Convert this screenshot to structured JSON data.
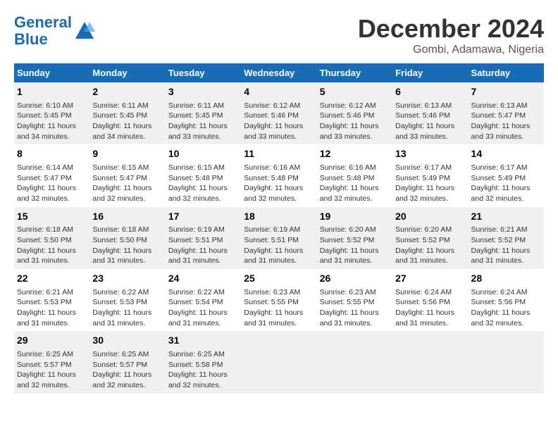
{
  "logo": {
    "line1": "General",
    "line2": "Blue"
  },
  "title": "December 2024",
  "location": "Gombi, Adamawa, Nigeria",
  "headers": [
    "Sunday",
    "Monday",
    "Tuesday",
    "Wednesday",
    "Thursday",
    "Friday",
    "Saturday"
  ],
  "weeks": [
    [
      {
        "day": "1",
        "info": "Sunrise: 6:10 AM\nSunset: 5:45 PM\nDaylight: 11 hours\nand 34 minutes."
      },
      {
        "day": "2",
        "info": "Sunrise: 6:11 AM\nSunset: 5:45 PM\nDaylight: 11 hours\nand 34 minutes."
      },
      {
        "day": "3",
        "info": "Sunrise: 6:11 AM\nSunset: 5:45 PM\nDaylight: 11 hours\nand 33 minutes."
      },
      {
        "day": "4",
        "info": "Sunrise: 6:12 AM\nSunset: 5:46 PM\nDaylight: 11 hours\nand 33 minutes."
      },
      {
        "day": "5",
        "info": "Sunrise: 6:12 AM\nSunset: 5:46 PM\nDaylight: 11 hours\nand 33 minutes."
      },
      {
        "day": "6",
        "info": "Sunrise: 6:13 AM\nSunset: 5:46 PM\nDaylight: 11 hours\nand 33 minutes."
      },
      {
        "day": "7",
        "info": "Sunrise: 6:13 AM\nSunset: 5:47 PM\nDaylight: 11 hours\nand 33 minutes."
      }
    ],
    [
      {
        "day": "8",
        "info": "Sunrise: 6:14 AM\nSunset: 5:47 PM\nDaylight: 11 hours\nand 32 minutes."
      },
      {
        "day": "9",
        "info": "Sunrise: 6:15 AM\nSunset: 5:47 PM\nDaylight: 11 hours\nand 32 minutes."
      },
      {
        "day": "10",
        "info": "Sunrise: 6:15 AM\nSunset: 5:48 PM\nDaylight: 11 hours\nand 32 minutes."
      },
      {
        "day": "11",
        "info": "Sunrise: 6:16 AM\nSunset: 5:48 PM\nDaylight: 11 hours\nand 32 minutes."
      },
      {
        "day": "12",
        "info": "Sunrise: 6:16 AM\nSunset: 5:48 PM\nDaylight: 11 hours\nand 32 minutes."
      },
      {
        "day": "13",
        "info": "Sunrise: 6:17 AM\nSunset: 5:49 PM\nDaylight: 11 hours\nand 32 minutes."
      },
      {
        "day": "14",
        "info": "Sunrise: 6:17 AM\nSunset: 5:49 PM\nDaylight: 11 hours\nand 32 minutes."
      }
    ],
    [
      {
        "day": "15",
        "info": "Sunrise: 6:18 AM\nSunset: 5:50 PM\nDaylight: 11 hours\nand 31 minutes."
      },
      {
        "day": "16",
        "info": "Sunrise: 6:18 AM\nSunset: 5:50 PM\nDaylight: 11 hours\nand 31 minutes."
      },
      {
        "day": "17",
        "info": "Sunrise: 6:19 AM\nSunset: 5:51 PM\nDaylight: 11 hours\nand 31 minutes."
      },
      {
        "day": "18",
        "info": "Sunrise: 6:19 AM\nSunset: 5:51 PM\nDaylight: 11 hours\nand 31 minutes."
      },
      {
        "day": "19",
        "info": "Sunrise: 6:20 AM\nSunset: 5:52 PM\nDaylight: 11 hours\nand 31 minutes."
      },
      {
        "day": "20",
        "info": "Sunrise: 6:20 AM\nSunset: 5:52 PM\nDaylight: 11 hours\nand 31 minutes."
      },
      {
        "day": "21",
        "info": "Sunrise: 6:21 AM\nSunset: 5:52 PM\nDaylight: 11 hours\nand 31 minutes."
      }
    ],
    [
      {
        "day": "22",
        "info": "Sunrise: 6:21 AM\nSunset: 5:53 PM\nDaylight: 11 hours\nand 31 minutes."
      },
      {
        "day": "23",
        "info": "Sunrise: 6:22 AM\nSunset: 5:53 PM\nDaylight: 11 hours\nand 31 minutes."
      },
      {
        "day": "24",
        "info": "Sunrise: 6:22 AM\nSunset: 5:54 PM\nDaylight: 11 hours\nand 31 minutes."
      },
      {
        "day": "25",
        "info": "Sunrise: 6:23 AM\nSunset: 5:55 PM\nDaylight: 11 hours\nand 31 minutes."
      },
      {
        "day": "26",
        "info": "Sunrise: 6:23 AM\nSunset: 5:55 PM\nDaylight: 11 hours\nand 31 minutes."
      },
      {
        "day": "27",
        "info": "Sunrise: 6:24 AM\nSunset: 5:56 PM\nDaylight: 11 hours\nand 31 minutes."
      },
      {
        "day": "28",
        "info": "Sunrise: 6:24 AM\nSunset: 5:56 PM\nDaylight: 11 hours\nand 32 minutes."
      }
    ],
    [
      {
        "day": "29",
        "info": "Sunrise: 6:25 AM\nSunset: 5:57 PM\nDaylight: 11 hours\nand 32 minutes."
      },
      {
        "day": "30",
        "info": "Sunrise: 6:25 AM\nSunset: 5:57 PM\nDaylight: 11 hours\nand 32 minutes."
      },
      {
        "day": "31",
        "info": "Sunrise: 6:25 AM\nSunset: 5:58 PM\nDaylight: 11 hours\nand 32 minutes."
      },
      {
        "day": "",
        "info": ""
      },
      {
        "day": "",
        "info": ""
      },
      {
        "day": "",
        "info": ""
      },
      {
        "day": "",
        "info": ""
      }
    ]
  ]
}
